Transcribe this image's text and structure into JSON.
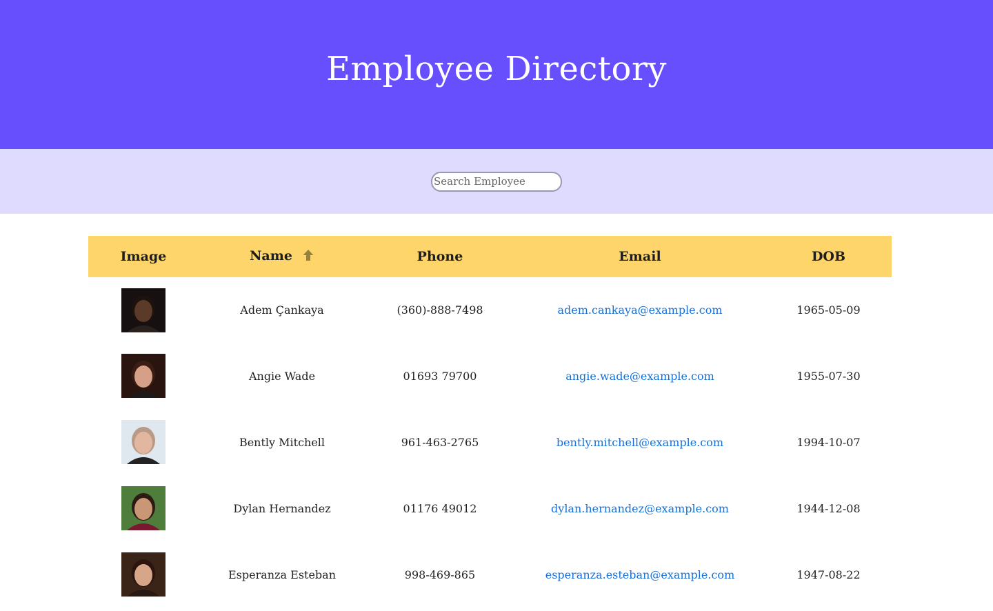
{
  "header": {
    "title": "Employee Directory"
  },
  "search": {
    "placeholder": "Search Employee",
    "value": ""
  },
  "table": {
    "columns": [
      "Image",
      "Name",
      "Phone",
      "Email",
      "DOB"
    ],
    "sort": {
      "column": "Name",
      "direction": "ascending",
      "icon": "arrow-up-icon"
    },
    "rows": [
      {
        "name": "Adem Çankaya",
        "phone": "(360)-888-7498",
        "email": "adem.cankaya@example.com",
        "dob": "1965-05-09",
        "skin": "#5b3a2a",
        "hair": "#1d120c",
        "bg": "#161010",
        "shirt": "#2a201c"
      },
      {
        "name": "Angie Wade",
        "phone": "01693 79700",
        "email": "angie.wade@example.com",
        "dob": "1955-07-30",
        "skin": "#d6a088",
        "hair": "#3b1d14",
        "bg": "#2a1410",
        "shirt": "#1e1a1a"
      },
      {
        "name": "Bently Mitchell",
        "phone": "961-463-2765",
        "email": "bently.mitchell@example.com",
        "dob": "1994-10-07",
        "skin": "#e2b7a0",
        "hair": "#b89a86",
        "bg": "#dfe8ee",
        "shirt": "#232323"
      },
      {
        "name": "Dylan Hernandez",
        "phone": "01176 49012",
        "email": "dylan.hernandez@example.com",
        "dob": "1944-12-08",
        "skin": "#c99676",
        "hair": "#2b1b12",
        "bg": "#4f7d3b",
        "shirt": "#7a1830"
      },
      {
        "name": "Esperanza Esteban",
        "phone": "998-469-865",
        "email": "esperanza.esteban@example.com",
        "dob": "1947-08-22",
        "skin": "#d7a689",
        "hair": "#2a1510",
        "bg": "#3a2418",
        "shirt": "#2a1814"
      }
    ]
  }
}
